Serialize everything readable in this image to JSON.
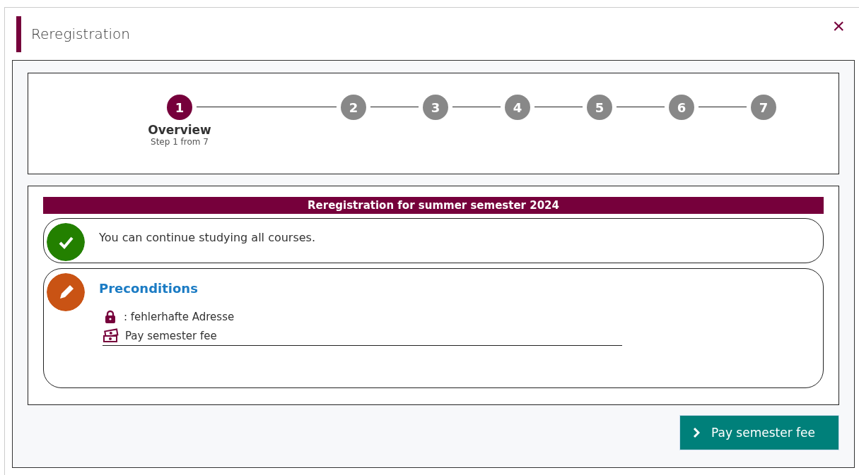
{
  "dialog": {
    "title": "Reregistration",
    "close": "×"
  },
  "steps": [
    {
      "number": "1",
      "label": "Overview",
      "sublabel": "Step 1 from 7",
      "selected": true
    },
    {
      "number": "2",
      "selected": false
    },
    {
      "number": "3",
      "selected": false
    },
    {
      "number": "4",
      "selected": false
    },
    {
      "number": "5",
      "selected": false
    },
    {
      "number": "6",
      "selected": false
    },
    {
      "number": "7",
      "selected": false
    }
  ],
  "banner": "Reregistration for summer semester 2024",
  "panels": [
    {
      "kind": "success",
      "text": "You can continue studying all courses."
    },
    {
      "kind": "task",
      "title": "Preconditions",
      "items": [
        {
          "kind": "lock",
          "text": ": fehlerhafte Adresse",
          "underlined": false
        },
        {
          "kind": "money",
          "text": "Pay semester fee",
          "underlined": true
        }
      ]
    }
  ],
  "action_button": {
    "label": "Pay semester fee"
  }
}
